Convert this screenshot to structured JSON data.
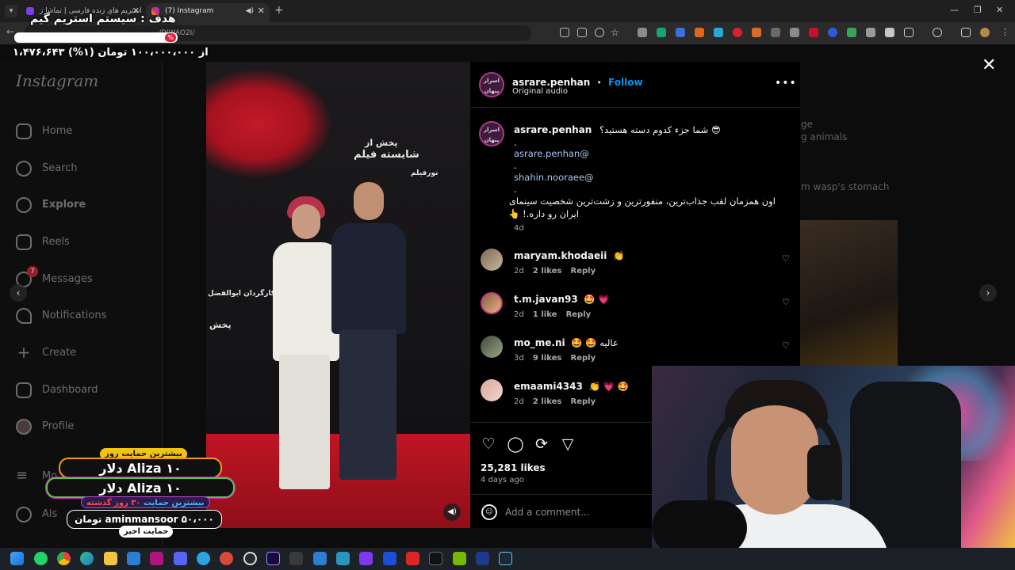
{
  "browser": {
    "tabs": [
      {
        "title": "استریم های زنده فارسی | تماشا ز",
        "active": false
      },
      {
        "title": "(7) Instagram",
        "active": true
      }
    ],
    "url": "/DlWAO2I/"
  },
  "overlay": {
    "goal_title": "هدف : سیستم استریم گیم",
    "goal_percent": "%",
    "goal_amount": "۱،۴۷۶،۶۴۳ از ۱۰۰،۰۰۰،۰۰۰ تومان (۱%)"
  },
  "sidebar": {
    "logo": "Instagram",
    "items": [
      {
        "label": "Home",
        "icon": "home-icon"
      },
      {
        "label": "Search",
        "icon": "search-icon"
      },
      {
        "label": "Explore",
        "icon": "compass-icon"
      },
      {
        "label": "Reels",
        "icon": "reels-icon"
      },
      {
        "label": "Messages",
        "icon": "messenger-icon",
        "badge": "7"
      },
      {
        "label": "Notifications",
        "icon": "heart-icon"
      },
      {
        "label": "Create",
        "icon": "plus-icon"
      },
      {
        "label": "Dashboard",
        "icon": "dashboard-icon"
      },
      {
        "label": "Profile",
        "icon": "avatar-icon"
      },
      {
        "label": "Mo",
        "icon": "menu-icon"
      },
      {
        "label": "Als",
        "icon": "threads-icon"
      }
    ]
  },
  "background_feed": {
    "lines": [
      "ge",
      "g animals",
      "m wasp's stomach"
    ]
  },
  "media": {
    "wall_text": [
      "پخش از",
      "شایسته فیلم",
      "کارگردان ابوالفضل",
      "نورفیلم",
      "پخش"
    ]
  },
  "post": {
    "author": "asrare.penhan",
    "author_avatar_text": "اسرار پنهان",
    "follow_label": "Follow",
    "dot": "•",
    "audio": "Original audio",
    "caption_title": "شما جزء کدوم دسته هستید؟ 😎",
    "caption_dot": ".",
    "mention1": "asrare.penhan@",
    "mention2": "shahin.nooraee@",
    "caption_body_1": "اون همزمان لقب جذاب‌ترین، منفورترین و زشت‌ترین شخصیت سینمای",
    "caption_body_2": "ایران رو داره.! 👆",
    "caption_time": "4d",
    "comments": [
      {
        "user": "maryam.khodaeii",
        "text": "👏",
        "time": "2d",
        "likes": "2 likes",
        "reply": "Reply"
      },
      {
        "user": "t.m.javan93",
        "text": "🤩 💗",
        "time": "2d",
        "likes": "1 like",
        "reply": "Reply"
      },
      {
        "user": "mo_me.ni",
        "text": "🤩 🤩 عالیه",
        "time": "3d",
        "likes": "9 likes",
        "reply": "Reply"
      },
      {
        "user": "emaami4343",
        "text": "👏 💗 🤩",
        "time": "2d",
        "likes": "2 likes",
        "reply": "Reply"
      }
    ],
    "likes_count": "25,281 likes",
    "posted_ago": "4 days ago",
    "comment_placeholder": "Add a comment..."
  },
  "donations": {
    "top_day_label": "بیشترین حمایت روز",
    "top_day": "Aliza  ۱۰ دلار",
    "top_30_label_a": "بیشترین حمایت",
    "top_30_label_b": "۳۰ روز گذشته",
    "top_30": "Aliza  ۱۰ دلار",
    "recent": "aminmansoor  ۵۰،۰۰۰ تومان",
    "recent_label": "حمایت اخیر"
  },
  "colors": {
    "accent_blue": "#0095f6",
    "instagram_bg": "#000000",
    "live_red": "#e0203a"
  }
}
